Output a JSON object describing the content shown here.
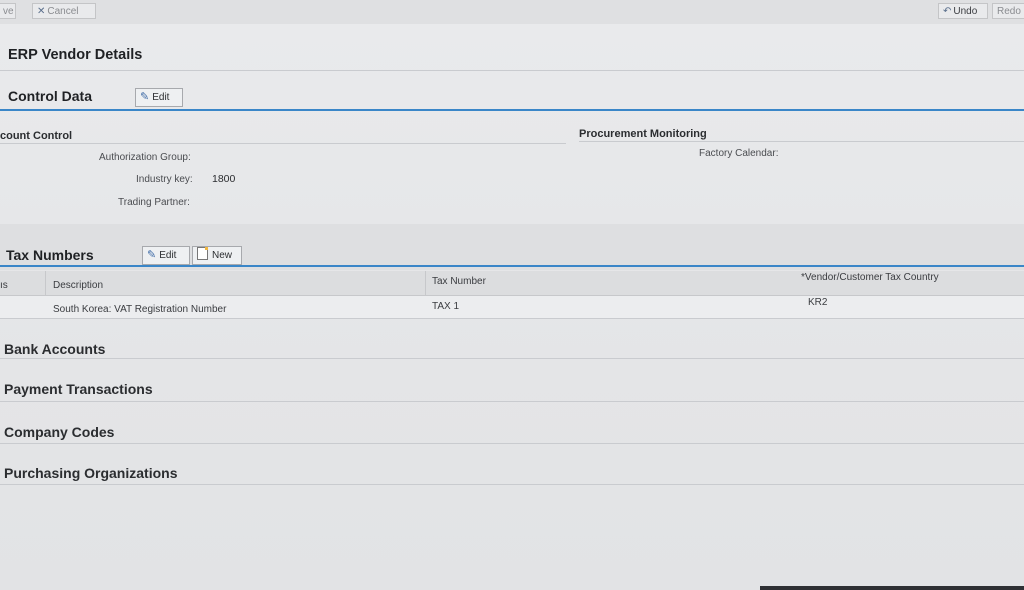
{
  "toolbar": {
    "save_label": "ve",
    "cancel_label": "Cancel",
    "undo_label": "Undo",
    "redo_label": "Redo"
  },
  "page": {
    "title": "ERP Vendor Details"
  },
  "control_data": {
    "title": "Control Data",
    "edit_label": "Edit",
    "account_control": {
      "heading": "count Control",
      "fields": [
        {
          "label": "Authorization Group:",
          "value": ""
        },
        {
          "label": "Industry key:",
          "value": "1800"
        },
        {
          "label": "Trading Partner:",
          "value": ""
        }
      ]
    },
    "procurement_monitoring": {
      "heading": "Procurement Monitoring",
      "fields": [
        {
          "label": "Factory Calendar:",
          "value": ""
        }
      ]
    }
  },
  "tax_numbers": {
    "title": "Tax Numbers",
    "edit_label": "Edit",
    "new_label": "New",
    "columns": [
      "ıs",
      "Description",
      "Tax Number",
      "*Vendor/Customer Tax Country"
    ],
    "rows": [
      {
        "description": "South Korea: VAT Registration Number",
        "tax_number": "TAX 1",
        "country": "KR2"
      }
    ]
  },
  "trays": [
    {
      "title": "Bank Accounts"
    },
    {
      "title": "Payment Transactions"
    },
    {
      "title": "Company Codes"
    },
    {
      "title": "Purchasing Organizations"
    }
  ]
}
